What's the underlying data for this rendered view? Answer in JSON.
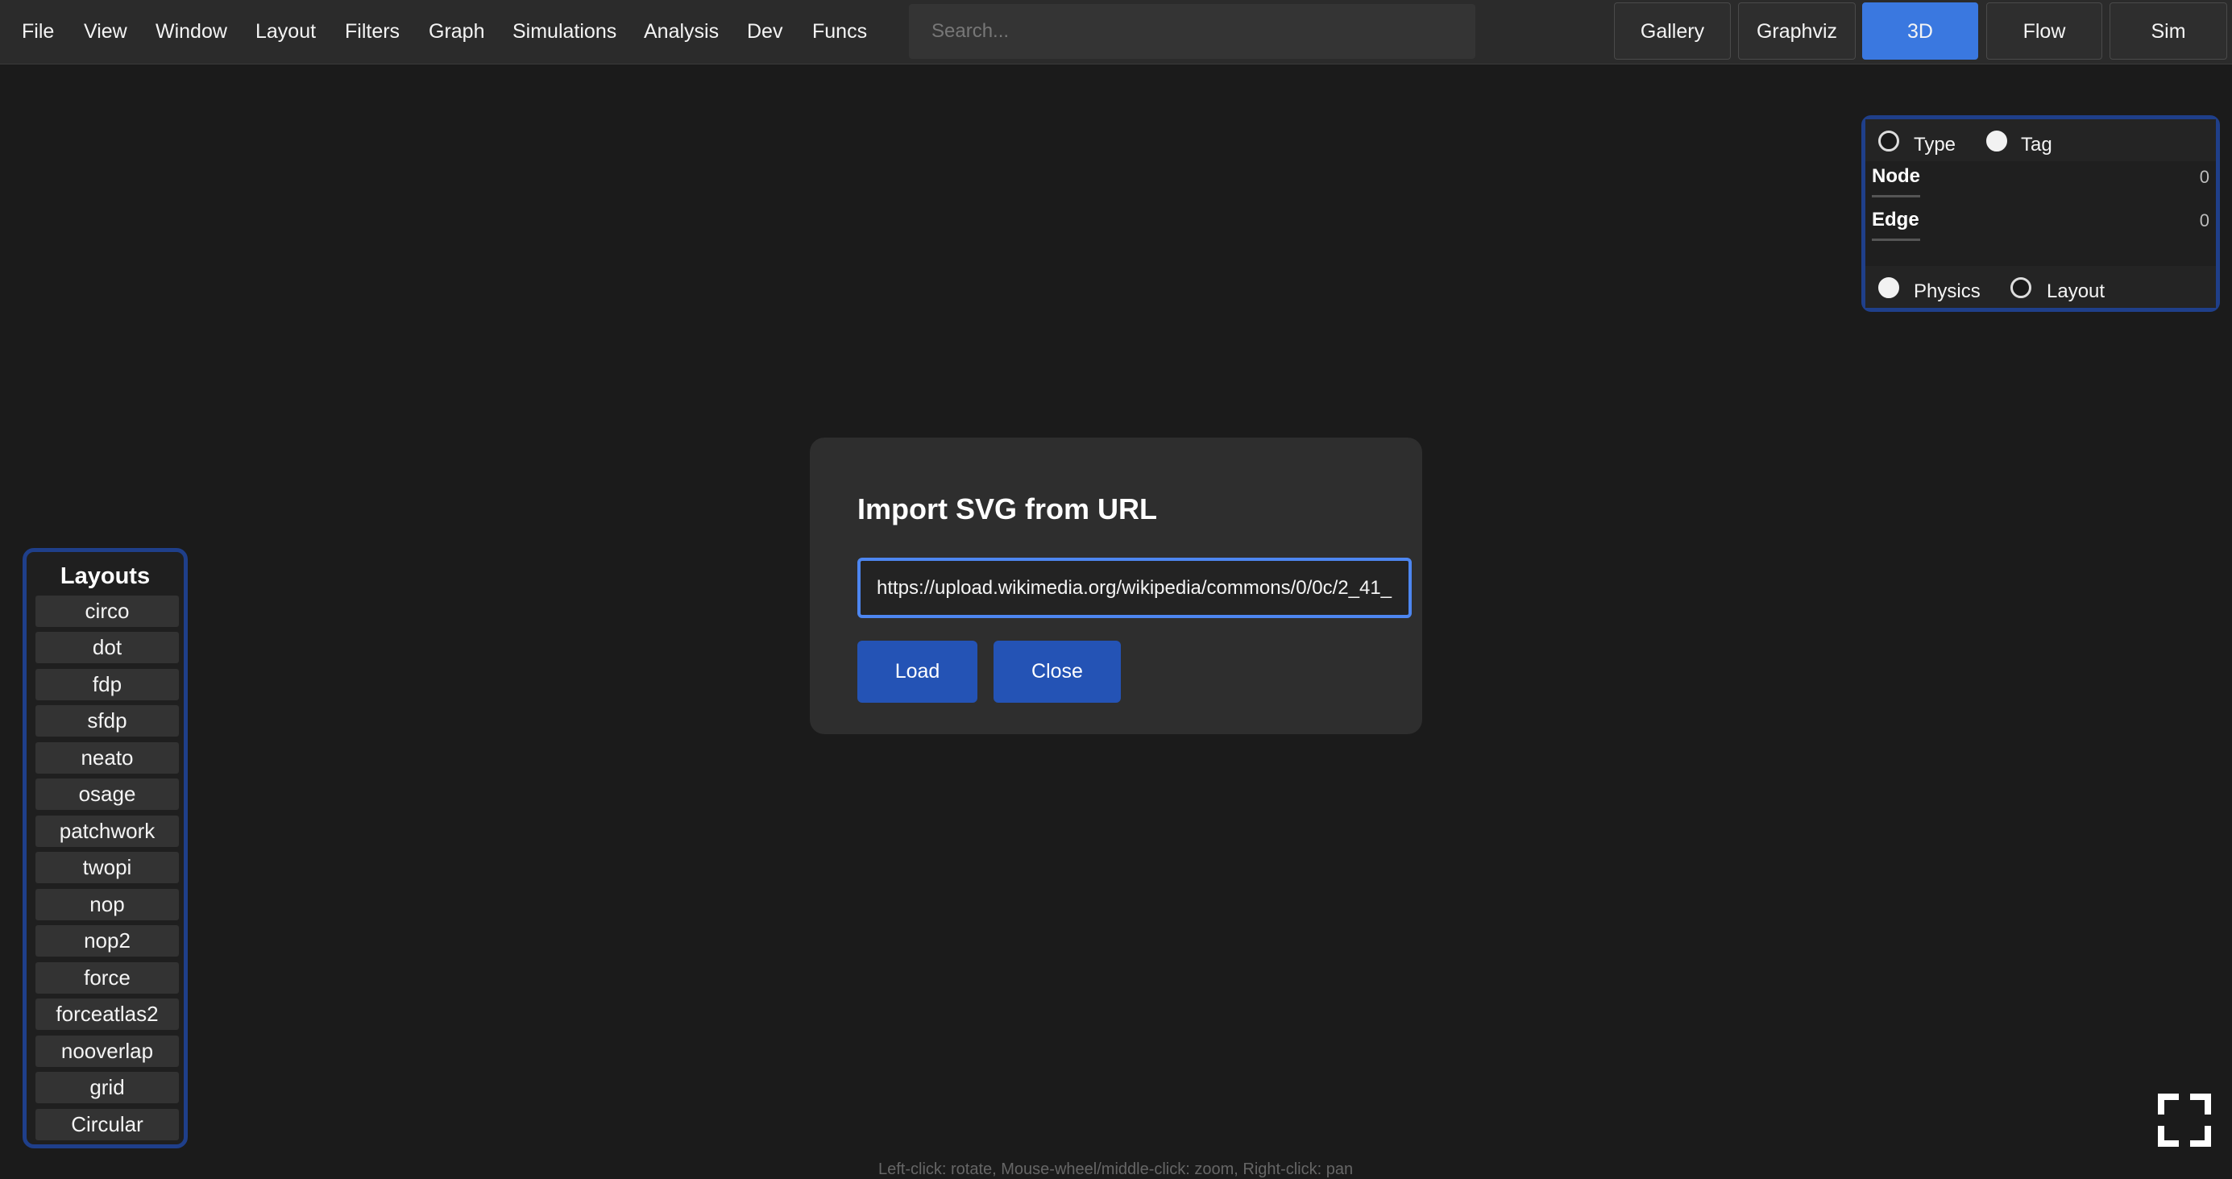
{
  "menu": {
    "items": [
      "File",
      "View",
      "Window",
      "Layout",
      "Filters",
      "Graph",
      "Simulations",
      "Analysis",
      "Dev",
      "Funcs"
    ]
  },
  "search": {
    "placeholder": "Search...",
    "value": ""
  },
  "view_tabs": {
    "items": [
      "Gallery",
      "Graphviz",
      "3D",
      "Flow",
      "Sim"
    ],
    "active": "3D",
    "active_color": "#3a78e0"
  },
  "stats_panel": {
    "radio_top": [
      {
        "label": "Type",
        "selected": false
      },
      {
        "label": "Tag",
        "selected": true
      }
    ],
    "rows": [
      {
        "label": "Node",
        "value": "0"
      },
      {
        "label": "Edge",
        "value": "0"
      }
    ],
    "radio_bottom": [
      {
        "label": "Physics",
        "selected": true
      },
      {
        "label": "Layout",
        "selected": false
      }
    ],
    "border_color": "#1f3f8a"
  },
  "layouts_panel": {
    "title": "Layouts",
    "items": [
      "circo",
      "dot",
      "fdp",
      "sfdp",
      "neato",
      "osage",
      "patchwork",
      "twopi",
      "nop",
      "nop2",
      "force",
      "forceatlas2",
      "nooverlap",
      "grid",
      "Circular"
    ]
  },
  "modal": {
    "title": "Import SVG from URL",
    "url_value": "https://upload.wikimedia.org/wikipedia/commons/0/0c/2_41_",
    "load_label": "Load",
    "close_label": "Close",
    "button_color": "#2453b5",
    "input_border_color": "#4d86f0"
  },
  "fullscreen_icon": "fullscreen-icon",
  "hint": "Left-click: rotate, Mouse-wheel/middle-click: zoom, Right-click: pan"
}
